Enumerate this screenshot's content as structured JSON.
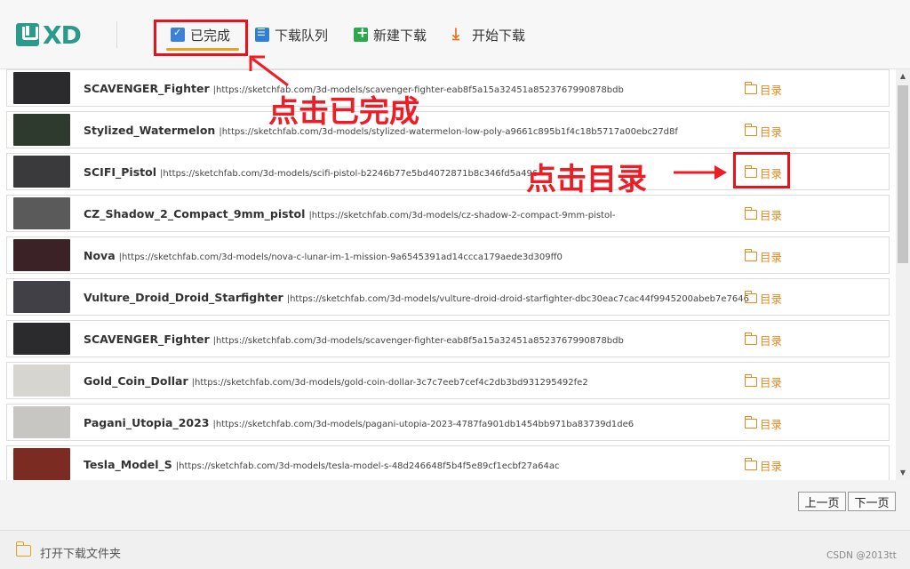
{
  "app": {
    "logo_text": "XD",
    "brand_color": "#2a9a8a"
  },
  "toolbar": {
    "completed_label": "已完成",
    "queue_label": "下载队列",
    "new_label": "新建下载",
    "start_label": "开始下载"
  },
  "annotations": {
    "click_completed": "点击已完成",
    "click_directory": "点击目录"
  },
  "list": {
    "dir_label": "目录",
    "items": [
      {
        "title": "SCAVENGER_Fighter",
        "url": "|https://sketchfab.com/3d-models/scavenger-fighter-eab8f5a15a32451a8523767990878bdb"
      },
      {
        "title": "Stylized_Watermelon",
        "url": "|https://sketchfab.com/3d-models/stylized-watermelon-low-poly-a9661c895b1f4c18b5717a00ebc27d8f"
      },
      {
        "title": "SCIFI_Pistol",
        "url": "|https://sketchfab.com/3d-models/scifi-pistol-b2246b77e5bd4072871b8c346fd5a496"
      },
      {
        "title": "CZ_Shadow_2_Compact_9mm_pistol",
        "url": "|https://sketchfab.com/3d-models/cz-shadow-2-compact-9mm-pistol-"
      },
      {
        "title": "Nova",
        "url": "|https://sketchfab.com/3d-models/nova-c-lunar-im-1-mission-9a6545391ad14ccca179aede3d309ff0"
      },
      {
        "title": "Vulture_Droid_Droid_Starfighter",
        "url": "|https://sketchfab.com/3d-models/vulture-droid-droid-starfighter-dbc30eac7cac44f9945200abeb7e7646"
      },
      {
        "title": "SCAVENGER_Fighter",
        "url": "|https://sketchfab.com/3d-models/scavenger-fighter-eab8f5a15a32451a8523767990878bdb"
      },
      {
        "title": "Gold_Coin_Dollar",
        "url": "|https://sketchfab.com/3d-models/gold-coin-dollar-3c7c7eeb7cef4c2db3bd931295492fe2"
      },
      {
        "title": "Pagani_Utopia_2023",
        "url": "|https://sketchfab.com/3d-models/pagani-utopia-2023-4787fa901db1454bb971ba83739d1de6"
      },
      {
        "title": "Tesla_Model_S",
        "url": "|https://sketchfab.com/3d-models/tesla-model-s-48d246648f5b4f5e89cf1ecbf27a64ac"
      }
    ]
  },
  "pager": {
    "prev_label": "上一页",
    "next_label": "下一页"
  },
  "footer": {
    "open_folder_label": "打开下载文件夹",
    "watermark": "CSDN @2013tt"
  },
  "colors": {
    "accent_orange": "#e8891f",
    "annotation_red": "#ee1c24",
    "tab_underline": "#e8a41f"
  }
}
